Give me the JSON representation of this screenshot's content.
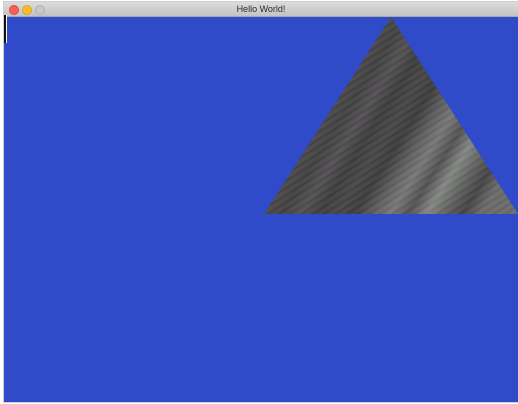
{
  "window": {
    "title": "Hello World!"
  },
  "colors": {
    "background": "#304bc9",
    "close": "#fb5f57",
    "minimize": "#fdbc2e",
    "maximize": "#c8c8c8"
  },
  "icons": {
    "close": "close-button-icon",
    "minimize": "minimize-button-icon",
    "maximize": "zoom-button-icon"
  }
}
